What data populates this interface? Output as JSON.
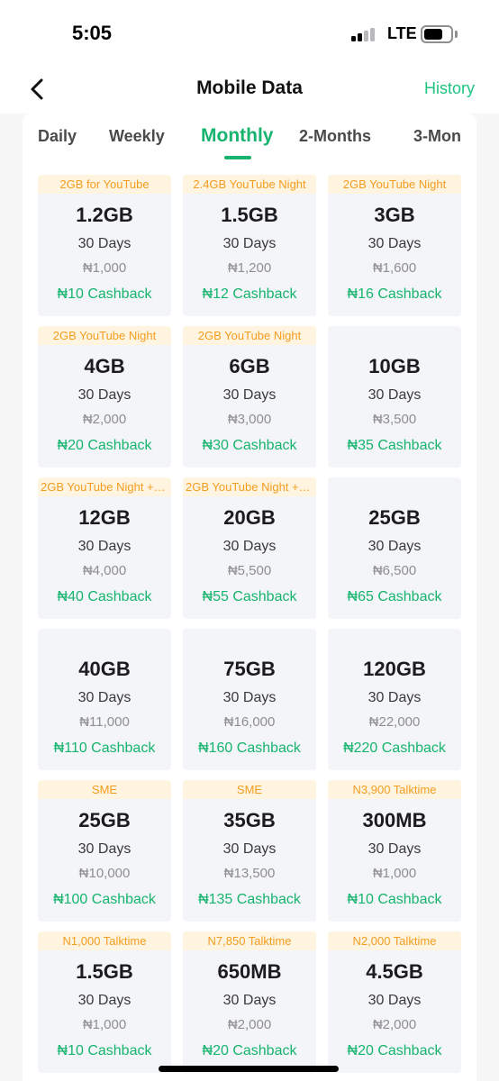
{
  "status_bar": {
    "time": "5:05",
    "network": "LTE"
  },
  "header": {
    "title": "Mobile Data",
    "history_label": "History"
  },
  "tabs": [
    {
      "label": "Daily"
    },
    {
      "label": "Weekly"
    },
    {
      "label": "Monthly",
      "active": true
    },
    {
      "label": "2-Months"
    },
    {
      "label": "3-Mon"
    }
  ],
  "plans": [
    {
      "tag": "2GB for YouTube",
      "size": "1.2GB",
      "validity": "30 Days",
      "price": "₦1,000",
      "cashback": "₦10 Cashback"
    },
    {
      "tag": "2.4GB YouTube Night",
      "size": "1.5GB",
      "validity": "30 Days",
      "price": "₦1,200",
      "cashback": "₦12 Cashback"
    },
    {
      "tag": "2GB YouTube Night",
      "size": "3GB",
      "validity": "30 Days",
      "price": "₦1,600",
      "cashback": "₦16 Cashback"
    },
    {
      "tag": "2GB YouTube Night",
      "size": "4GB",
      "validity": "30 Days",
      "price": "₦2,000",
      "cashback": "₦20 Cashback"
    },
    {
      "tag": "2GB YouTube Night",
      "size": "6GB",
      "validity": "30 Days",
      "price": "₦3,000",
      "cashback": "₦30 Cashback"
    },
    {
      "tag": "",
      "size": "10GB",
      "validity": "30 Days",
      "price": "₦3,500",
      "cashback": "₦35 Cashback"
    },
    {
      "tag": "2GB YouTube Night + 2...",
      "size": "12GB",
      "validity": "30 Days",
      "price": "₦4,000",
      "cashback": "₦40 Cashback"
    },
    {
      "tag": "2GB YouTube Night + 2...",
      "size": "20GB",
      "validity": "30 Days",
      "price": "₦5,500",
      "cashback": "₦55 Cashback"
    },
    {
      "tag": "",
      "size": "25GB",
      "validity": "30 Days",
      "price": "₦6,500",
      "cashback": "₦65 Cashback"
    },
    {
      "tag": "",
      "size": "40GB",
      "validity": "30 Days",
      "price": "₦11,000",
      "cashback": "₦110 Cashback"
    },
    {
      "tag": "",
      "size": "75GB",
      "validity": "30 Days",
      "price": "₦16,000",
      "cashback": "₦160 Cashback"
    },
    {
      "tag": "",
      "size": "120GB",
      "validity": "30 Days",
      "price": "₦22,000",
      "cashback": "₦220 Cashback"
    },
    {
      "tag": "SME",
      "size": "25GB",
      "validity": "30 Days",
      "price": "₦10,000",
      "cashback": "₦100 Cashback"
    },
    {
      "tag": "SME",
      "size": "35GB",
      "validity": "30 Days",
      "price": "₦13,500",
      "cashback": "₦135 Cashback"
    },
    {
      "tag": "N3,900 Talktime",
      "size": "300MB",
      "validity": "30 Days",
      "price": "₦1,000",
      "cashback": "₦10 Cashback"
    },
    {
      "tag": "N1,000 Talktime",
      "size": "1.5GB",
      "validity": "30 Days",
      "price": "₦1,000",
      "cashback": "₦10 Cashback"
    },
    {
      "tag": "N7,850 Talktime",
      "size": "650MB",
      "validity": "30 Days",
      "price": "₦2,000",
      "cashback": "₦20 Cashback"
    },
    {
      "tag": "N2,000 Talktime",
      "size": "4.5GB",
      "validity": "30 Days",
      "price": "₦2,000",
      "cashback": "₦20 Cashback"
    }
  ],
  "colors": {
    "accent": "#16b46e",
    "history": "#1ec47f",
    "tag_text": "#f39d1f",
    "tag_bg": "#fff4e0",
    "card_bg": "#f4f5f8",
    "price": "#8e8e93"
  },
  "icons": {
    "back": "chevron-left-icon",
    "signal": "signal-bars-icon",
    "battery": "battery-icon"
  }
}
